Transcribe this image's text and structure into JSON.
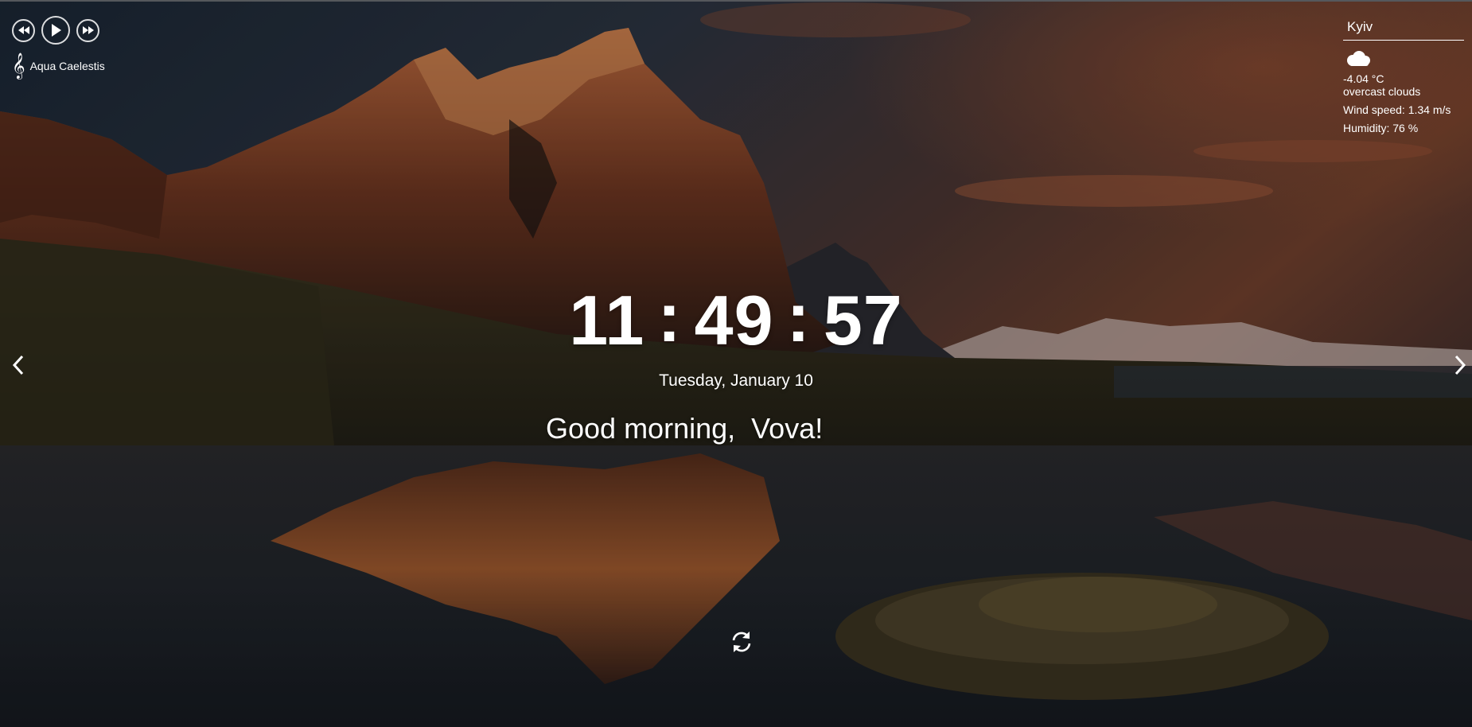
{
  "player": {
    "buttons": [
      "prev-icon",
      "play-icon",
      "next-icon"
    ],
    "track_icon": "treble-clef-icon",
    "track_name": "Aqua Caelestis"
  },
  "weather": {
    "city": "Kyiv",
    "icon": "cloud-icon",
    "temperature": "-4.04 °C",
    "description": "overcast clouds",
    "wind": "Wind speed: 1.34 m/s",
    "humidity": "Humidity: 76 %"
  },
  "clock": {
    "hours": "11",
    "minutes": "49",
    "seconds": "57",
    "separator": ":"
  },
  "date": "Tuesday, January 10",
  "greeting": {
    "text": "Good morning, ",
    "name": "Vova!"
  },
  "slider": {
    "prev_icon": "chevron-left-icon",
    "next_icon": "chevron-right-icon"
  },
  "quote": {
    "refresh_icon": "refresh-icon"
  },
  "colors": {
    "text": "#ffffff",
    "sky_dark": "#1c2a3c",
    "sunset": "#c0613a"
  }
}
